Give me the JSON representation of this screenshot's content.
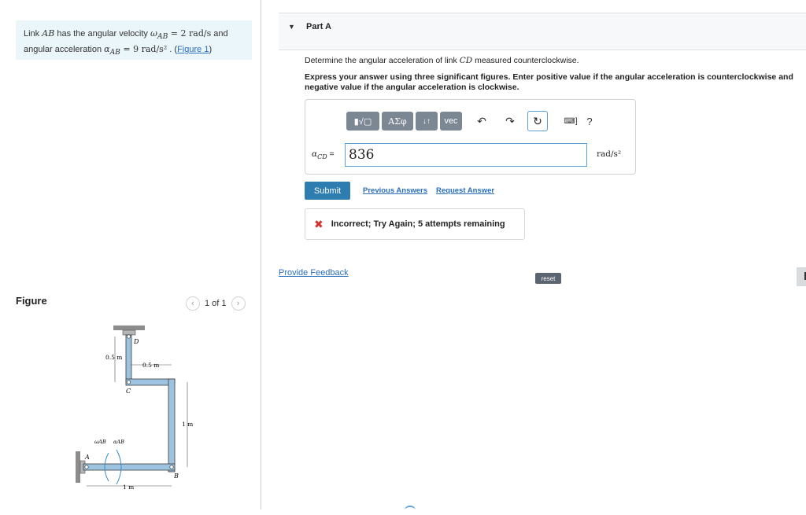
{
  "problem": {
    "text_before": "Link ",
    "link_name": "AB",
    "text_mid1": " has the angular velocity ",
    "omega_symbol": "ω",
    "omega_sub": "AB",
    "omega_value": " = 2 rad/s",
    "text_mid2": " and angular acceleration ",
    "alpha_symbol": "α",
    "alpha_sub": "AB",
    "alpha_value": " = 9 rad/s²",
    "text_end": " . (",
    "figure_link": "Figure 1",
    "text_close": ")"
  },
  "figure_panel": {
    "title": "Figure",
    "pager_text": "1 of 1",
    "prev_icon": "chevron-left-icon",
    "next_icon": "chevron-right-icon",
    "labels": {
      "D": "D",
      "C": "C",
      "A": "A",
      "B": "B",
      "dim_05_left": "0.5 m",
      "dim_05_top": "0.5 m",
      "dim_1m_right": "1 m",
      "dim_1m_bottom": "1 m",
      "omega_ab": "ωAB",
      "alpha_ab": "αAB"
    },
    "colors": {
      "member": "#9cc3e0",
      "member_edge": "#3c3c3c",
      "support": "#8c8c8c"
    }
  },
  "part_a": {
    "title": "Part A",
    "question_pre": "Determine the angular acceleration of link ",
    "question_link": "CD",
    "question_post": " measured counterclockwise.",
    "instructions": "Express your answer using three significant figures. Enter positive value if the angular acceleration is counterclockwise and negative value if the angular acceleration is clockwise.",
    "toolbar": {
      "templates_label": "▮√▢",
      "greek_label": "ΑΣφ",
      "arrows_label": "↓↑",
      "vec_label": "vec",
      "undo_icon": "↶",
      "redo_icon": "↷",
      "reset_icon": "↻",
      "keyboard_icon": "⌨]",
      "help_label": "?"
    },
    "variable_symbol": "α",
    "variable_sub": "CD",
    "variable_eq": " =",
    "answer_value": "836",
    "unit": "rad/s²",
    "submit_label": "Submit",
    "previous_answers_label": "Previous Answers",
    "request_answer_label": "Request Answer",
    "feedback_icon": "✖",
    "feedback_text": "Incorrect; Try Again; 5 attempts remaining",
    "colors": {
      "submit_bg": "#2e7db1",
      "error": "#d0342c",
      "link": "#2a6ebb"
    }
  },
  "footer": {
    "provide_feedback_label": "Provide Feedback",
    "reset_label": "reset"
  }
}
